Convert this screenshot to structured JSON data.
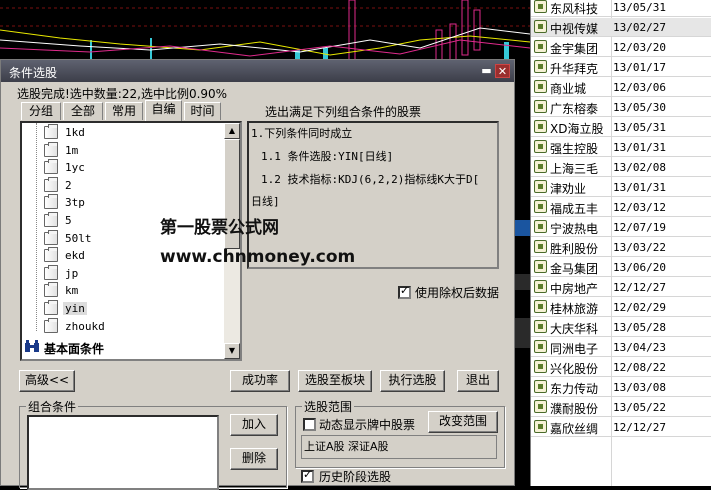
{
  "dialog": {
    "title": "条件选股",
    "status": "选股完成!选中数量:22,选中比例0.90%",
    "tabs": [
      "分组",
      "全部",
      "常用",
      "自编",
      "时间"
    ],
    "active_tab": "自编",
    "condition_heading": "选出满足下列组合条件的股票",
    "tree_items": [
      "1kd",
      "1m",
      "1yc",
      "2",
      "3tp",
      "5",
      "50lt",
      "ekd",
      "jp",
      "km",
      "yin",
      "zhoukd"
    ],
    "selected_tree_item": "yin",
    "fundamental_label": "基本面条件",
    "conditions": {
      "line1": "1.下列条件同时成立",
      "line2": "1.1 条件选股:YIN[日线]",
      "line3": "1.2 技术指标:KDJ(6,2,2)指标线K大于D[",
      "line4": "日线]"
    },
    "use_adjusted_label": "使用除权后数据",
    "use_adjusted_checked": true,
    "buttons": {
      "advanced": "高级<<",
      "success_rate": "成功率",
      "to_sector": "选股至板块",
      "execute": "执行选股",
      "exit": "退出",
      "add": "加入",
      "delete": "删除",
      "change_range": "改变范围"
    },
    "combo_group_label": "组合条件",
    "range_group_label": "选股范围",
    "dynamic_display_label": "动态显示牌中股票",
    "dynamic_display_checked": false,
    "range_value": "上证A股 深证A股",
    "history_label": "历史阶段选股",
    "history_checked": true
  },
  "watermark": {
    "line1": "第一股票公式网",
    "line2": "www.chnmoney.com"
  },
  "stock_list": [
    {
      "name": "东风科技",
      "date": "13/05/31"
    },
    {
      "name": "中视传媒",
      "date": "13/02/27"
    },
    {
      "name": "金宇集团",
      "date": "12/03/20"
    },
    {
      "name": "升华拜克",
      "date": "13/01/17"
    },
    {
      "name": "商业城",
      "date": "12/03/06"
    },
    {
      "name": "广东榕泰",
      "date": "13/05/30"
    },
    {
      "name": "XD海立股",
      "date": "13/05/31"
    },
    {
      "name": "强生控股",
      "date": "13/01/31"
    },
    {
      "name": "上海三毛",
      "date": "13/02/08"
    },
    {
      "name": "津劝业",
      "date": "13/01/31"
    },
    {
      "name": "福成五丰",
      "date": "12/03/12"
    },
    {
      "name": "宁波热电",
      "date": "12/07/19"
    },
    {
      "name": "胜利股份",
      "date": "13/03/22"
    },
    {
      "name": "金马集团",
      "date": "13/06/20"
    },
    {
      "name": "中房地产",
      "date": "12/12/27"
    },
    {
      "name": "桂林旅游",
      "date": "12/02/29"
    },
    {
      "name": "大庆华科",
      "date": "13/05/28"
    },
    {
      "name": "同洲电子",
      "date": "13/04/23"
    },
    {
      "name": "兴化股份",
      "date": "12/08/22"
    },
    {
      "name": "东力传动",
      "date": "13/03/08"
    },
    {
      "name": "濮耐股份",
      "date": "13/05/22"
    },
    {
      "name": "嘉欣丝绸",
      "date": "12/12/27"
    }
  ],
  "selected_stock": "中视传媒",
  "colors": {
    "chart_bg": "#000000",
    "candle_up": "#e02a8c",
    "line_yellow": "#e8e800",
    "line_white": "#ffffff",
    "dialog_bg": "#d4d0c8",
    "titlebar": "#4a4d58"
  }
}
